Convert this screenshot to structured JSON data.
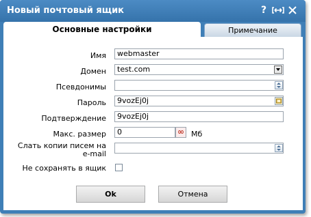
{
  "window": {
    "title": "Новый почтовый ящик",
    "help_icon": "?",
    "maximize_icon": "[↔]",
    "close_icon": "✕"
  },
  "tabs": [
    {
      "label": "Основные настройки",
      "active": true
    },
    {
      "label": "Примечание",
      "active": false
    }
  ],
  "form": {
    "name": {
      "label": "Имя",
      "value": "webmaster"
    },
    "domain": {
      "label": "Домен",
      "value": "test.com"
    },
    "aliases": {
      "label": "Псевдонимы",
      "value": ""
    },
    "password": {
      "label": "Пароль",
      "value": "9vozEj0j"
    },
    "confirm": {
      "label": "Подтверждение",
      "value": "9vozEj0j"
    },
    "max_size": {
      "label": "Макс. размер",
      "value": "0",
      "unit": "Мб",
      "infinity_icon": "∞"
    },
    "copy_email": {
      "label_line1": "Слать копии писем на",
      "label_line2": "e-mail",
      "value": ""
    },
    "no_save": {
      "label": "Не сохранять в ящик",
      "checked": false
    }
  },
  "buttons": {
    "ok": "Ok",
    "cancel": "Отмена"
  },
  "colors": {
    "titlebar": "#3f7fb7",
    "accent_red": "#c0392b"
  }
}
